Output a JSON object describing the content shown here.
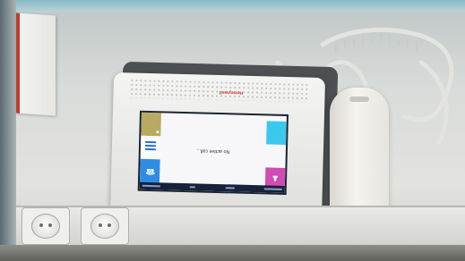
{
  "screen": {
    "message": "No active call...",
    "menu_icon": "hamburger-menu-icon",
    "tiles": [
      {
        "name": "olive-tile",
        "color": "#b9aa63"
      },
      {
        "name": "cyan-tile",
        "color": "#3ac9ec"
      },
      {
        "name": "blue-tile",
        "color": "#2f8ce5",
        "icon": "phone-icon"
      },
      {
        "name": "magenta-tile",
        "color": "#d04bb2",
        "icon": "person-icon"
      }
    ]
  },
  "panel": {
    "brand": "Honeywell"
  }
}
